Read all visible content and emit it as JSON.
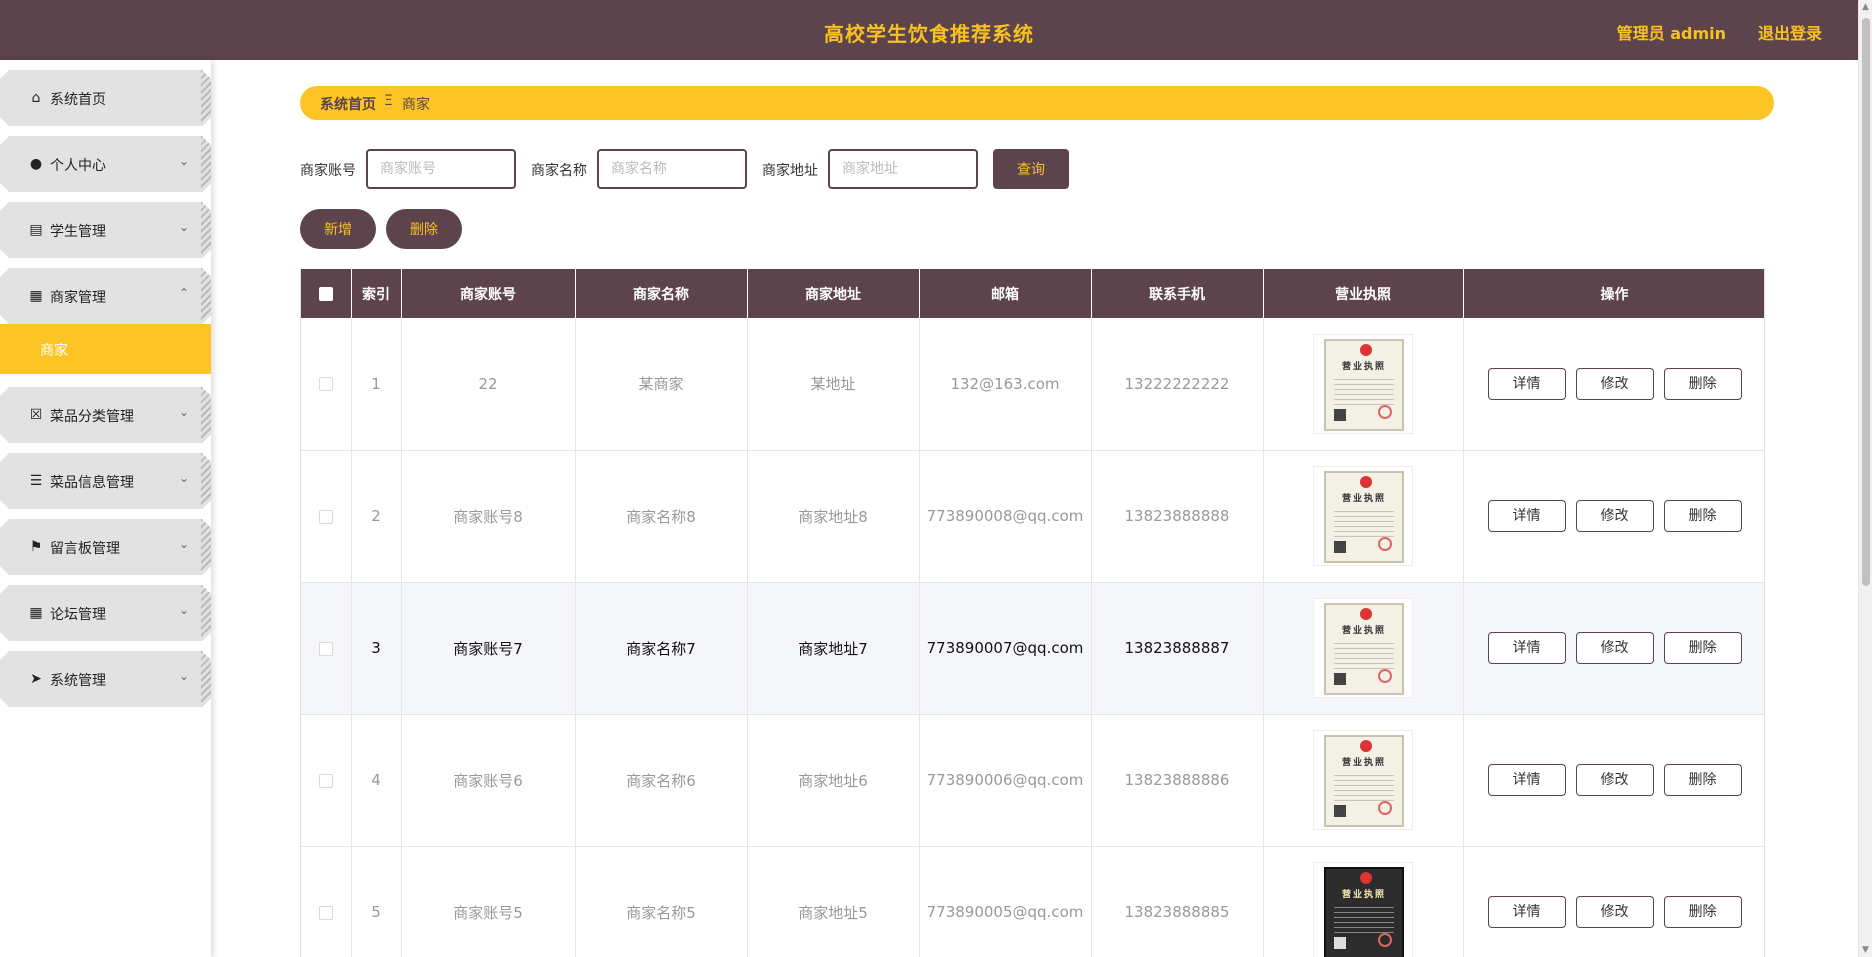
{
  "header": {
    "title": "高校学生饮食推荐系统",
    "user": "管理员 admin",
    "logout": "退出登录"
  },
  "sidebar": {
    "items": [
      {
        "label": "系统首页",
        "icon": "home-icon",
        "glyph": "⌂",
        "arrow": ""
      },
      {
        "label": "个人中心",
        "icon": "user-icon",
        "glyph": "●",
        "arrow": "⌄"
      },
      {
        "label": "学生管理",
        "icon": "clipboard-icon",
        "glyph": "▤",
        "arrow": "⌄"
      },
      {
        "label": "商家管理",
        "icon": "grid-icon",
        "glyph": "▦",
        "arrow": "⌃"
      },
      {
        "label": "菜品分类管理",
        "icon": "x-box-icon",
        "glyph": "☒",
        "arrow": "⌄"
      },
      {
        "label": "菜品信息管理",
        "icon": "sliders-icon",
        "glyph": "☰",
        "arrow": "⌄"
      },
      {
        "label": "留言板管理",
        "icon": "flag-icon",
        "glyph": "⚑",
        "arrow": "⌄"
      },
      {
        "label": "论坛管理",
        "icon": "grid-icon",
        "glyph": "▦",
        "arrow": "⌄"
      },
      {
        "label": "系统管理",
        "icon": "send-icon",
        "glyph": "➤",
        "arrow": "⌄"
      }
    ],
    "submenu": {
      "label": "商家"
    }
  },
  "breadcrumb": {
    "home": "系统首页",
    "separator": "Ξ",
    "current": "商家"
  },
  "search": {
    "account_label": "商家账号",
    "account_placeholder": "商家账号",
    "name_label": "商家名称",
    "name_placeholder": "商家名称",
    "address_label": "商家地址",
    "address_placeholder": "商家地址",
    "query_label": "查询"
  },
  "actions": {
    "add_label": "新增",
    "delete_label": "删除"
  },
  "table": {
    "headers": [
      "索引",
      "商家账号",
      "商家名称",
      "商家地址",
      "邮箱",
      "联系手机",
      "营业执照",
      "操作"
    ],
    "rows": [
      {
        "index": "1",
        "account": "22",
        "name": "某商家",
        "address": "某地址",
        "email": "132@163.com",
        "phone": "13222222222"
      },
      {
        "index": "2",
        "account": "商家账号8",
        "name": "商家名称8",
        "address": "商家地址8",
        "email": "773890008@qq.com",
        "phone": "13823888888"
      },
      {
        "index": "3",
        "account": "商家账号7",
        "name": "商家名称7",
        "address": "商家地址7",
        "email": "773890007@qq.com",
        "phone": "13823888887"
      },
      {
        "index": "4",
        "account": "商家账号6",
        "name": "商家名称6",
        "address": "商家地址6",
        "email": "773890006@qq.com",
        "phone": "13823888886"
      },
      {
        "index": "5",
        "account": "商家账号5",
        "name": "商家名称5",
        "address": "商家地址5",
        "email": "773890005@qq.com",
        "phone": "13823888885"
      }
    ],
    "license_text": "营业执照",
    "row_buttons": {
      "detail": "详情",
      "edit": "修改",
      "delete": "删除"
    }
  },
  "colors": {
    "brand": "#5d434c",
    "accent": "#fcc525"
  }
}
